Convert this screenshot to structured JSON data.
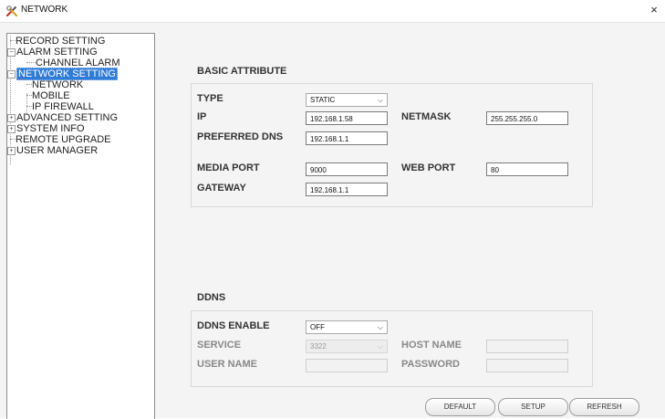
{
  "window": {
    "title": "NETWORK",
    "close_glyph": "×",
    "app_icon": "tools-icon"
  },
  "tree": {
    "items": [
      {
        "label": "RECORD SETTING"
      },
      {
        "label": "ALARM SETTING",
        "toggle": "−"
      },
      {
        "label": "CHANNEL ALARM"
      },
      {
        "label": "NETWORK SETTING",
        "toggle": "−",
        "selected": true
      },
      {
        "label": "NETWORK"
      },
      {
        "label": "MOBILE"
      },
      {
        "label": "IP FIREWALL"
      },
      {
        "label": "ADVANCED SETTING",
        "toggle": "+"
      },
      {
        "label": "SYSTEM INFO",
        "toggle": "+"
      },
      {
        "label": "REMOTE UPGRADE"
      },
      {
        "label": "USER MANAGER",
        "toggle": "+"
      }
    ]
  },
  "basic": {
    "title": "BASIC ATTRIBUTE",
    "type_label": "TYPE",
    "type_value": "STATIC",
    "ip_label": "IP",
    "ip_value": "192.168.1.58",
    "netmask_label": "NETMASK",
    "netmask_value": "255.255.255.0",
    "dns_label": "PREFERRED DNS",
    "dns_value": "192.168.1.1",
    "media_port_label": "MEDIA PORT",
    "media_port_value": "9000",
    "web_port_label": "WEB PORT",
    "web_port_value": "80",
    "gateway_label": "GATEWAY",
    "gateway_value": "192.168.1.1"
  },
  "ddns": {
    "title": "DDNS",
    "enable_label": "DDNS ENABLE",
    "enable_value": "OFF",
    "service_label": "SERVICE",
    "service_value": "3322",
    "host_label": "HOST NAME",
    "host_value": "",
    "user_label": "USER NAME",
    "user_value": "",
    "password_label": "PASSWORD",
    "password_value": ""
  },
  "buttons": {
    "default": "DEFAULT",
    "setup": "SETUP",
    "refresh": "REFRESH"
  },
  "colors": {
    "selection": "#2f7bd6",
    "panel_bg": "#f4f4f4"
  }
}
